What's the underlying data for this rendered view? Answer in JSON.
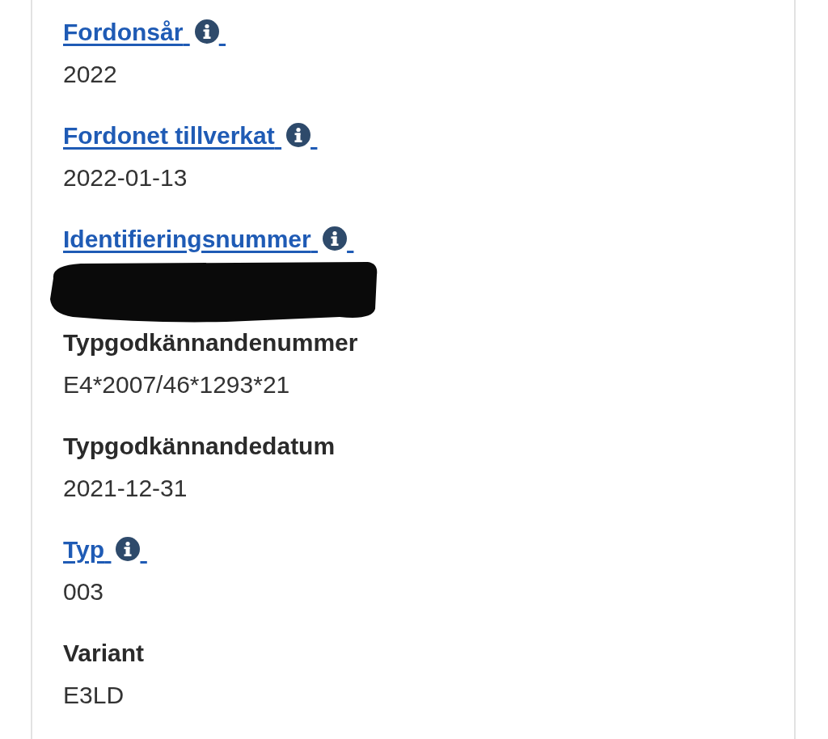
{
  "fields": [
    {
      "label": "Fordonsår",
      "link": true,
      "info": true,
      "value": "2022",
      "redacted": false
    },
    {
      "label": "Fordonet tillverkat",
      "link": true,
      "info": true,
      "value": "2022-01-13",
      "redacted": false
    },
    {
      "label": "Identifieringsnummer",
      "link": true,
      "info": true,
      "redacted": true
    },
    {
      "label": "Typgodkännandenummer",
      "link": false,
      "info": false,
      "value": "E4*2007/46*1293*21",
      "redacted": false
    },
    {
      "label": "Typgodkännandedatum",
      "link": false,
      "info": false,
      "value": "2021-12-31",
      "redacted": false
    },
    {
      "label": "Typ",
      "link": true,
      "info": true,
      "value": "003",
      "redacted": false
    },
    {
      "label": "Variant",
      "link": false,
      "info": false,
      "value": "E3LD",
      "redacted": false
    }
  ]
}
